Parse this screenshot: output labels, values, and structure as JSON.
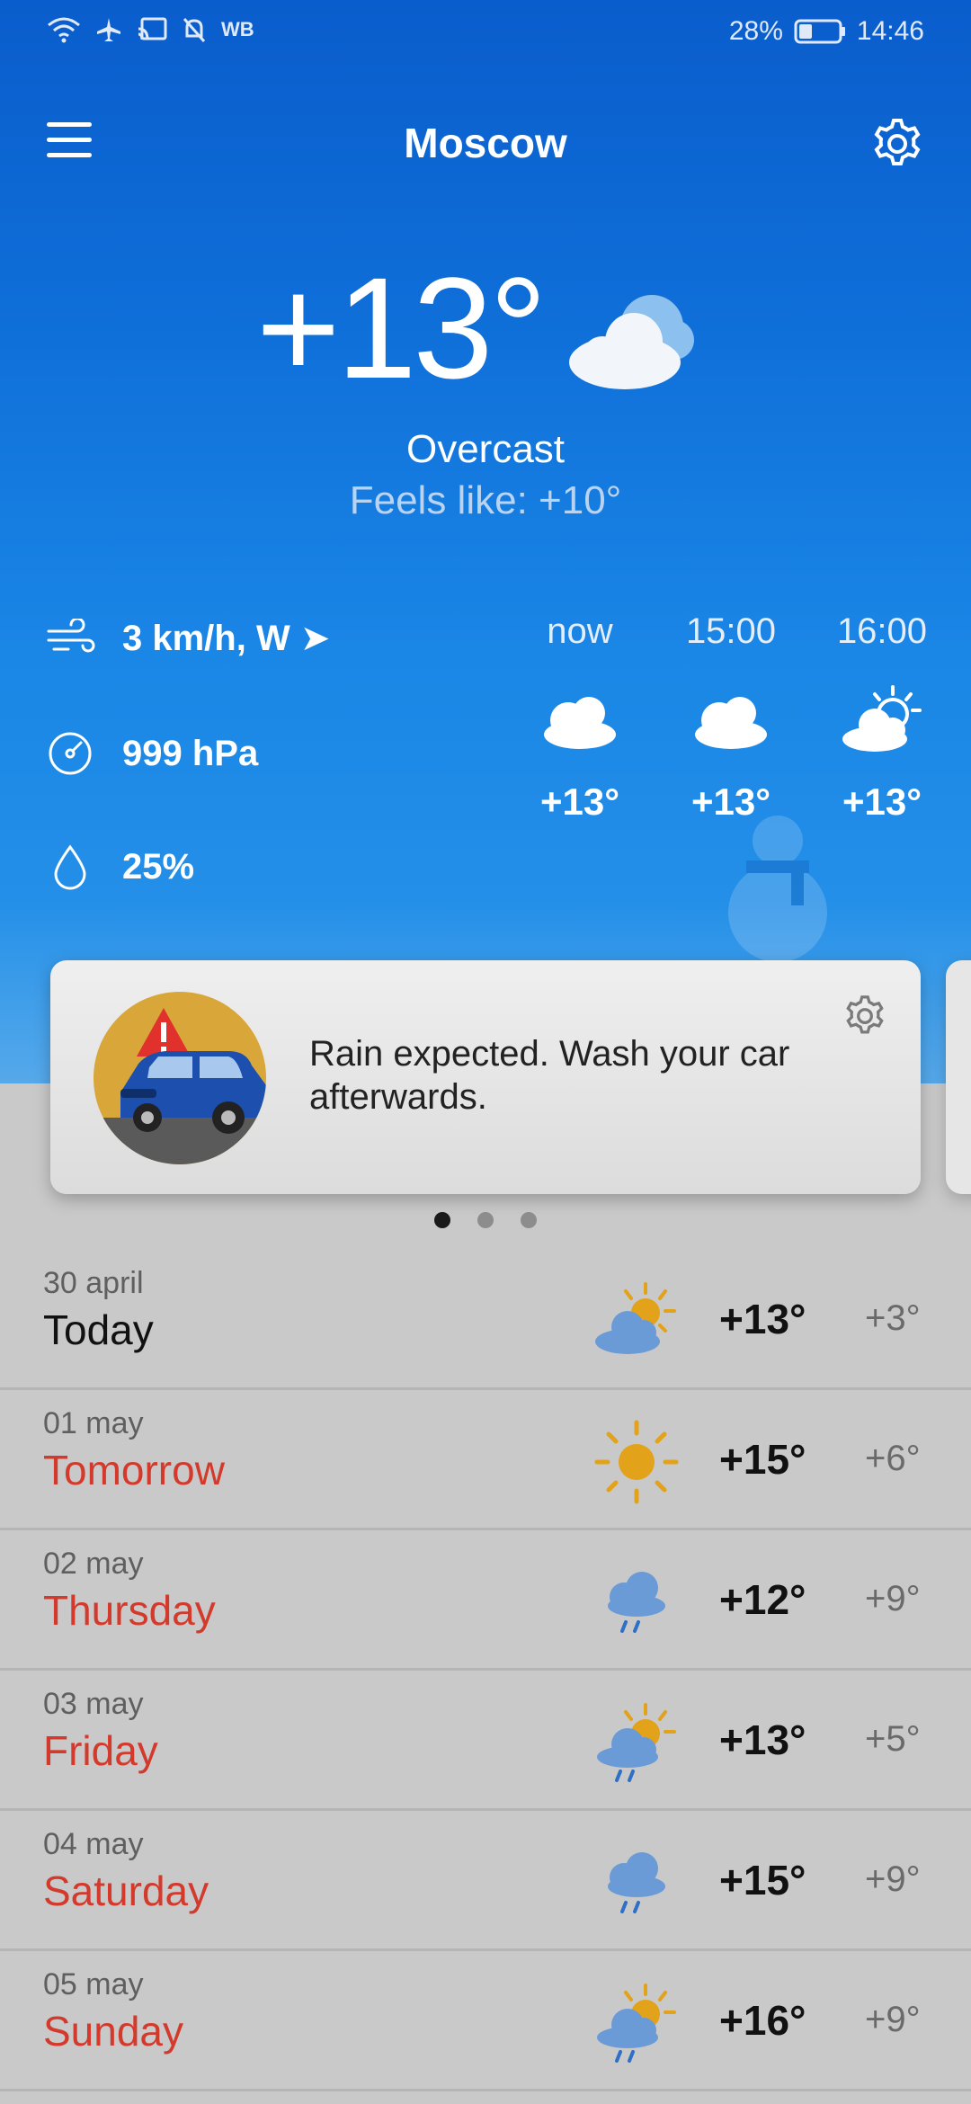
{
  "status_bar": {
    "carrier_badge": "WB",
    "battery": "28%",
    "time": "14:46",
    "icons": [
      "wifi-icon",
      "airplane-icon",
      "cast-icon",
      "bell-off-icon"
    ]
  },
  "header": {
    "city": "Moscow",
    "menu_icon": "hamburger-menu-icon",
    "settings_icon": "gear-icon"
  },
  "current": {
    "temperature": "+13°",
    "condition": "Overcast",
    "feels_like": "Feels like: +10°",
    "icon": "cloud-icon"
  },
  "details": {
    "wind": "3 km/h, W ➤",
    "pressure": "999 hPa",
    "humidity": "25%"
  },
  "hourly": [
    {
      "time": "now",
      "temp": "+13°",
      "icon": "cloud-icon"
    },
    {
      "time": "15:00",
      "temp": "+13°",
      "icon": "cloud-icon"
    },
    {
      "time": "16:00",
      "temp": "+13°",
      "icon": "partly-sunny-icon"
    }
  ],
  "alert": {
    "text": "Rain expected. Wash your car afterwards.",
    "icon": "car-warning-icon"
  },
  "pager": {
    "count": 3,
    "active": 0
  },
  "forecast": [
    {
      "date": "30 april",
      "day": "Today",
      "high": "+13°",
      "low": "+3°",
      "icon": "partly-cloudy-icon"
    },
    {
      "date": "01 may",
      "day": "Tomorrow",
      "high": "+15°",
      "low": "+6°",
      "icon": "sun-icon"
    },
    {
      "date": "02 may",
      "day": "Thursday",
      "high": "+12°",
      "low": "+9°",
      "icon": "rain-cloud-icon"
    },
    {
      "date": "03 may",
      "day": "Friday",
      "high": "+13°",
      "low": "+5°",
      "icon": "sun-rain-icon"
    },
    {
      "date": "04 may",
      "day": "Saturday",
      "high": "+15°",
      "low": "+9°",
      "icon": "rain-cloud-icon"
    },
    {
      "date": "05 may",
      "day": "Sunday",
      "high": "+16°",
      "low": "+9°",
      "icon": "sun-rain-icon"
    }
  ],
  "colors": {
    "hero_top": "#0a5dcc",
    "hero_bottom": "#2a96ea",
    "weekday_red": "#d33a2c",
    "sun": "#e2a21a",
    "cloud_blue": "#6a9bd6"
  }
}
